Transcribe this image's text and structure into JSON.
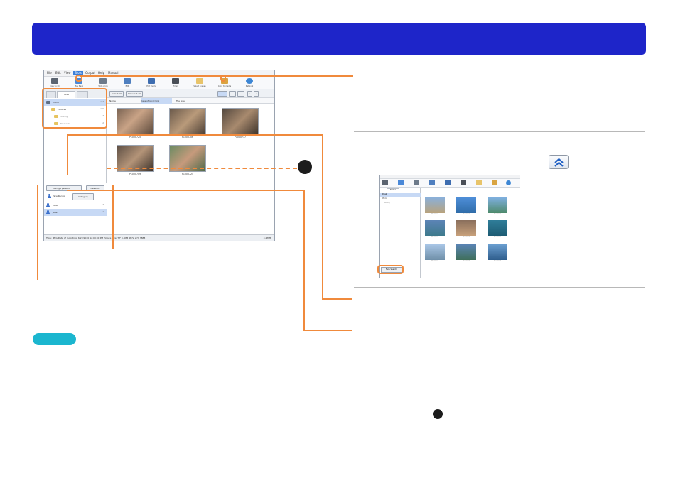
{
  "header": {
    "title": ""
  },
  "screenshot": {
    "menu": [
      "File",
      "Edit",
      "View",
      "Tools",
      "Output",
      "Help",
      "Manual"
    ],
    "active_menu": "Tools",
    "toolbar": [
      {
        "label": "Copy to PC",
        "icon": "copy-to-pc-icon",
        "color": "#5b6470"
      },
      {
        "label": "Play Back",
        "icon": "playback-icon",
        "color": "#4b89d8"
      },
      {
        "label": "Slide show",
        "icon": "slideshow-icon",
        "color": "#6d7a8a"
      },
      {
        "label": "Edit",
        "icon": "edit-icon",
        "color": "#4f7fbf"
      },
      {
        "label": "Edit movie",
        "icon": "edit-movie-icon",
        "color": "#3e6db0"
      },
      {
        "label": "Email",
        "icon": "email-icon",
        "color": "#4a4f57"
      },
      {
        "label": "Select scenes",
        "icon": "select-scenes-icon",
        "color": "#e8c46a"
      },
      {
        "label": "Copy to media",
        "icon": "copy-to-media-icon",
        "color": "#d9a441"
      },
      {
        "label": "Network",
        "icon": "network-icon",
        "color": "#3c86d4"
      }
    ],
    "tabs": [
      "",
      "Folder",
      ""
    ],
    "tree": [
      {
        "label": "In the",
        "count": "123"
      },
      {
        "label": "Pictures",
        "count": "100"
      },
      {
        "label": "Sublog",
        "count": "13"
      },
      {
        "label": "Elements",
        "count": "12"
      }
    ],
    "face_buttons": {
      "manage": "Manage persons",
      "deselect": "Deselect",
      "face_recog": "Face Recog.",
      "category": "Category"
    },
    "persons": [
      {
        "name": "Mike",
        "count": "3"
      },
      {
        "name": "Jane",
        "count": "2"
      }
    ],
    "select_all": "Select all",
    "deselect_all": "Deselect all",
    "sort_columns": [
      "Name",
      "Date of recording",
      "File size"
    ],
    "thumbnails": [
      "P1000725",
      "P1000706",
      "P1000717",
      "P1000709",
      "P1000724"
    ],
    "status": "Type: JPEG  Date of recording: 6/22/2020 12:00:00 PM  Picture Size: TIF 8.3MB  4872 x H: 3888",
    "status_right": "3.27MB"
  },
  "small_screenshot": {
    "tabs": [
      "Folder",
      "Drive"
    ],
    "tree": [
      "Desk",
      "Photo",
      "Sublog"
    ],
    "button": "Face Search",
    "labels": [
      "P1000600",
      "P1000601",
      "P1000602",
      "P1000603",
      "P1000604",
      "P1000605",
      "P1000606",
      "P1000607",
      "P1000608"
    ]
  },
  "colors": {
    "header": "#1e25c9",
    "callout": "#f08a3c",
    "pill": "#1bb6cf",
    "number_circle": "#1c1c1c"
  }
}
